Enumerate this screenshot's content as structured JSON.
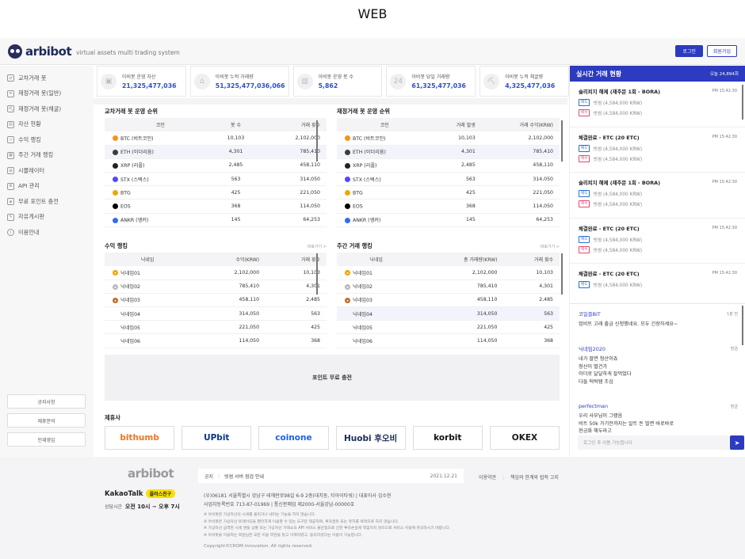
{
  "page_label": "WEB",
  "header": {
    "logo_text": "arbibot",
    "tagline": "virtual assets multi trading system",
    "login_label": "로그인",
    "signup_label": "회원가입"
  },
  "sidebar": {
    "items": [
      {
        "label": "교차거래 봇",
        "icon": "swap-icon"
      },
      {
        "label": "재정거래 봇(일반)",
        "icon": "arrows-icon"
      },
      {
        "label": "재정거래 봇(채굴)",
        "icon": "pickaxe-icon"
      },
      {
        "label": "자산 현황",
        "icon": "folder-icon"
      },
      {
        "label": "수익 랭킹",
        "icon": "chart-icon"
      },
      {
        "label": "주간 거래 랭킹",
        "icon": "calendar-icon"
      },
      {
        "label": "시뮬레이터",
        "icon": "grid-icon"
      },
      {
        "label": "API 관리",
        "icon": "api-icon"
      },
      {
        "label": "무료 포인트 충전",
        "icon": "gift-icon"
      },
      {
        "label": "자유게시판",
        "icon": "board-icon"
      },
      {
        "label": "이용안내",
        "icon": "info-icon"
      }
    ],
    "bottom_buttons": [
      "공지사항",
      "제휴문의",
      "인재영입"
    ]
  },
  "stats": [
    {
      "label": "아비봇 운영 자산",
      "value": "21,325,477,036",
      "icon": "wallet-icon"
    },
    {
      "label": "아비봇 누적 거래량",
      "value": "51,325,477,036,066",
      "icon": "bank-icon"
    },
    {
      "label": "아비봇 운영 봇 수",
      "value": "5,862",
      "icon": "building-icon"
    },
    {
      "label": "아비봇 당일 거래량",
      "value": "61,325,477,036",
      "icon": "24h-icon"
    },
    {
      "label": "아비봇 누적 채굴량",
      "value": "4,325,477,036",
      "icon": "pickaxe-icon"
    }
  ],
  "cross_bot": {
    "title": "교차거래 봇 운영 순위",
    "headers": [
      "코인",
      "봇 수",
      "거래 횟수"
    ],
    "rows": [
      {
        "coin": "BTC (비트코인)",
        "a": "10,103",
        "b": "2,102,000",
        "color": "#f7931a"
      },
      {
        "coin": "ETH (이더리움)",
        "a": "4,301",
        "b": "785,410",
        "color": "#3c3c3d",
        "hl": true
      },
      {
        "coin": "XRP (리플)",
        "a": "2,485",
        "b": "458,110",
        "color": "#222"
      },
      {
        "coin": "STX (스택스)",
        "a": "563",
        "b": "314,050",
        "color": "#5546ff"
      },
      {
        "coin": "BTG",
        "a": "425",
        "b": "221,050",
        "color": "#eba809"
      },
      {
        "coin": "EOS",
        "a": "368",
        "b": "114,050",
        "color": "#000"
      },
      {
        "coin": "ANKR (앵커)",
        "a": "145",
        "b": "64,253",
        "color": "#2e6bf6"
      }
    ]
  },
  "arb_bot": {
    "title": "재정거래 봇 운영 순위",
    "headers": [
      "코인",
      "거래 발생",
      "거래 수익(KRW)"
    ],
    "rows": [
      {
        "coin": "BTC (비트코인)",
        "a": "10,103",
        "b": "2,102,000",
        "color": "#f7931a"
      },
      {
        "coin": "ETH (이더리움)",
        "a": "4,301",
        "b": "785,410",
        "color": "#3c3c3d",
        "hl": true
      },
      {
        "coin": "XRP (리플)",
        "a": "2,485",
        "b": "458,110",
        "color": "#222"
      },
      {
        "coin": "STX (스택스)",
        "a": "563",
        "b": "314,050",
        "color": "#5546ff"
      },
      {
        "coin": "BTG",
        "a": "425",
        "b": "221,050",
        "color": "#eba809"
      },
      {
        "coin": "EOS",
        "a": "368",
        "b": "114,050",
        "color": "#000"
      },
      {
        "coin": "ANKR (앵커)",
        "a": "145",
        "b": "64,253",
        "color": "#2e6bf6"
      }
    ]
  },
  "profit_rank": {
    "title": "수익 랭킹",
    "more": "바로가기 >",
    "headers": [
      "닉네임",
      "수익(KRW)",
      "거래 횟수"
    ],
    "rows": [
      {
        "name": "닉네임01",
        "a": "2,102,000",
        "b": "10,103",
        "medal": "#f0a500"
      },
      {
        "name": "닉네임02",
        "a": "785,410",
        "b": "4,301",
        "medal": "#b8b8b8"
      },
      {
        "name": "닉네임03",
        "a": "458,110",
        "b": "2,485",
        "medal": "#c26a2a"
      },
      {
        "name": "닉네임04",
        "a": "314,050",
        "b": "563",
        "medal": ""
      },
      {
        "name": "닉네임05",
        "a": "221,050",
        "b": "425",
        "medal": ""
      },
      {
        "name": "닉네임06",
        "a": "114,050",
        "b": "368",
        "medal": ""
      }
    ]
  },
  "weekly_rank": {
    "title": "주간 거래 랭킹",
    "more": "바로가기 >",
    "headers": [
      "닉네임",
      "총 거래량(KRW)",
      "거래 횟수"
    ],
    "rows": [
      {
        "name": "닉네임01",
        "a": "2,102,000",
        "b": "10,103",
        "medal": "#f0a500"
      },
      {
        "name": "닉네임02",
        "a": "785,410",
        "b": "4,301",
        "medal": "#b8b8b8"
      },
      {
        "name": "닉네임03",
        "a": "458,110",
        "b": "2,485",
        "medal": "#c26a2a"
      },
      {
        "name": "닉네임04",
        "a": "314,050",
        "b": "563",
        "medal": "",
        "hl": true
      },
      {
        "name": "닉네임05",
        "a": "221,050",
        "b": "425",
        "medal": ""
      },
      {
        "name": "닉네임06",
        "a": "114,050",
        "b": "368",
        "medal": ""
      }
    ]
  },
  "point_banner": "포인트 무료 충전",
  "partners": {
    "title": "제휴사",
    "items": [
      {
        "name": "bithumb",
        "color": "#f37321"
      },
      {
        "name": "UPbit",
        "color": "#093687"
      },
      {
        "name": "coinone",
        "color": "#1a5ef5"
      },
      {
        "name": "Huobi 후오비",
        "color": "#1b2a55"
      },
      {
        "name": "korbit",
        "color": "#111"
      },
      {
        "name": "OKEX",
        "color": "#1a1a1a"
      }
    ]
  },
  "live": {
    "title": "실시간 거래 현황",
    "count": "오늘 24,894회",
    "trades": [
      {
        "title": "슬리피지 해제 (재주문 1회 - BORA)",
        "time": "PM 15:42:30",
        "buy": "빗썸 (4,584,000 KRW)",
        "sell": "빗썸 (4,584,000 KRW)"
      },
      {
        "title": "체결완료 - ETC (20 ETC)",
        "time": "PM 15:42:30",
        "buy": "빗썸 (4,584,000 KRW)",
        "sell": "빗썸 (4,584,000 KRW)"
      },
      {
        "title": "슬리피지 해제 (재주문 1회 - BORA)",
        "time": "PM 15:42:30",
        "buy": "빗썸 (4,584,000 KRW)",
        "sell": "빗썸 (4,584,000 KRW)"
      },
      {
        "title": "체결완료 - ETC (20 ETC)",
        "time": "PM 15:42:30",
        "buy": "빗썸 (4,584,000 KRW)",
        "sell": "빗썸 (4,584,000 KRW)"
      },
      {
        "title": "체결완료 - ETC (20 ETC)",
        "time": "PM 15:42:30",
        "buy": "빗썸 (4,584,000 KRW)",
        "sell": ""
      }
    ],
    "buy_tag": "매도",
    "sell_tag": "매수"
  },
  "chat": {
    "messages": [
      {
        "user": "코일즐BIT",
        "time": "1분 전",
        "text": [
          "업비트 고래 출금 신청했네요. 모두 긴장하세요~"
        ]
      },
      {
        "user": "닉네임2020",
        "time": "방금",
        "text": [
          "내가 팔면 청산이죠",
          "청산이 별건가",
          "이더로 달달하게 잘먹었다",
          "다들 떡락템 조심"
        ]
      },
      {
        "user": "perfectman",
        "time": "방금",
        "text": [
          "우리 사부님이 그랬음",
          "비트 50k 가기전까지는 알트 돈 벌면 바로바로",
          "현금화 해두라고"
        ]
      }
    ],
    "placeholder": "로그인 후 이용 가능합니다"
  },
  "footer": {
    "logo": "arbibot",
    "kakao": "KakaoTalk",
    "kakao_plus": "플러스친구",
    "hours_label": "상담시간",
    "hours": "오전 10시 ~ 오후 7시",
    "notice_label": "공지",
    "notice_text": "빗썸 서버 점검 안내",
    "notice_date": "2021.12.21",
    "links": [
      "이용약관",
      "책임의 한계와 법적 고지"
    ],
    "address1": "(우)06181 서울특별시 강남구 테헤란로98길 6-9 2층(대치동, 티아이타워)  |  대표이사 김수현",
    "address2": "사업자등록번호 713-87-01969  |  통신판매업 제2000-서울강남-00000호",
    "notes": [
      "※ 아비봇은 가상자산의 시세를 올리거나 내리는 기능을 하지 않습니다.",
      "※ 아비봇은 가상자산 트레이딩을 편리하게 이용할 수 있는 도구만 제공하며, 투자권유 또는 유치를 목적으로 하지 않습니다.",
      "※ 가상자산 급격한 시세 변동 상황 또는 가상자산 거래소의 API 서비스 불안정으로 인한 투자손실에 책임지지 않으므로 서비스 이용에 유의하시기 바랍니다.",
      "※ 아비봇을 이용하는 회원님은 모든 이용 약관을 읽고 이해하였고, 동의하셨다는 이용이 가능합니다."
    ],
    "copyright": "Copyright©CROM innovation. All rights reserved."
  }
}
